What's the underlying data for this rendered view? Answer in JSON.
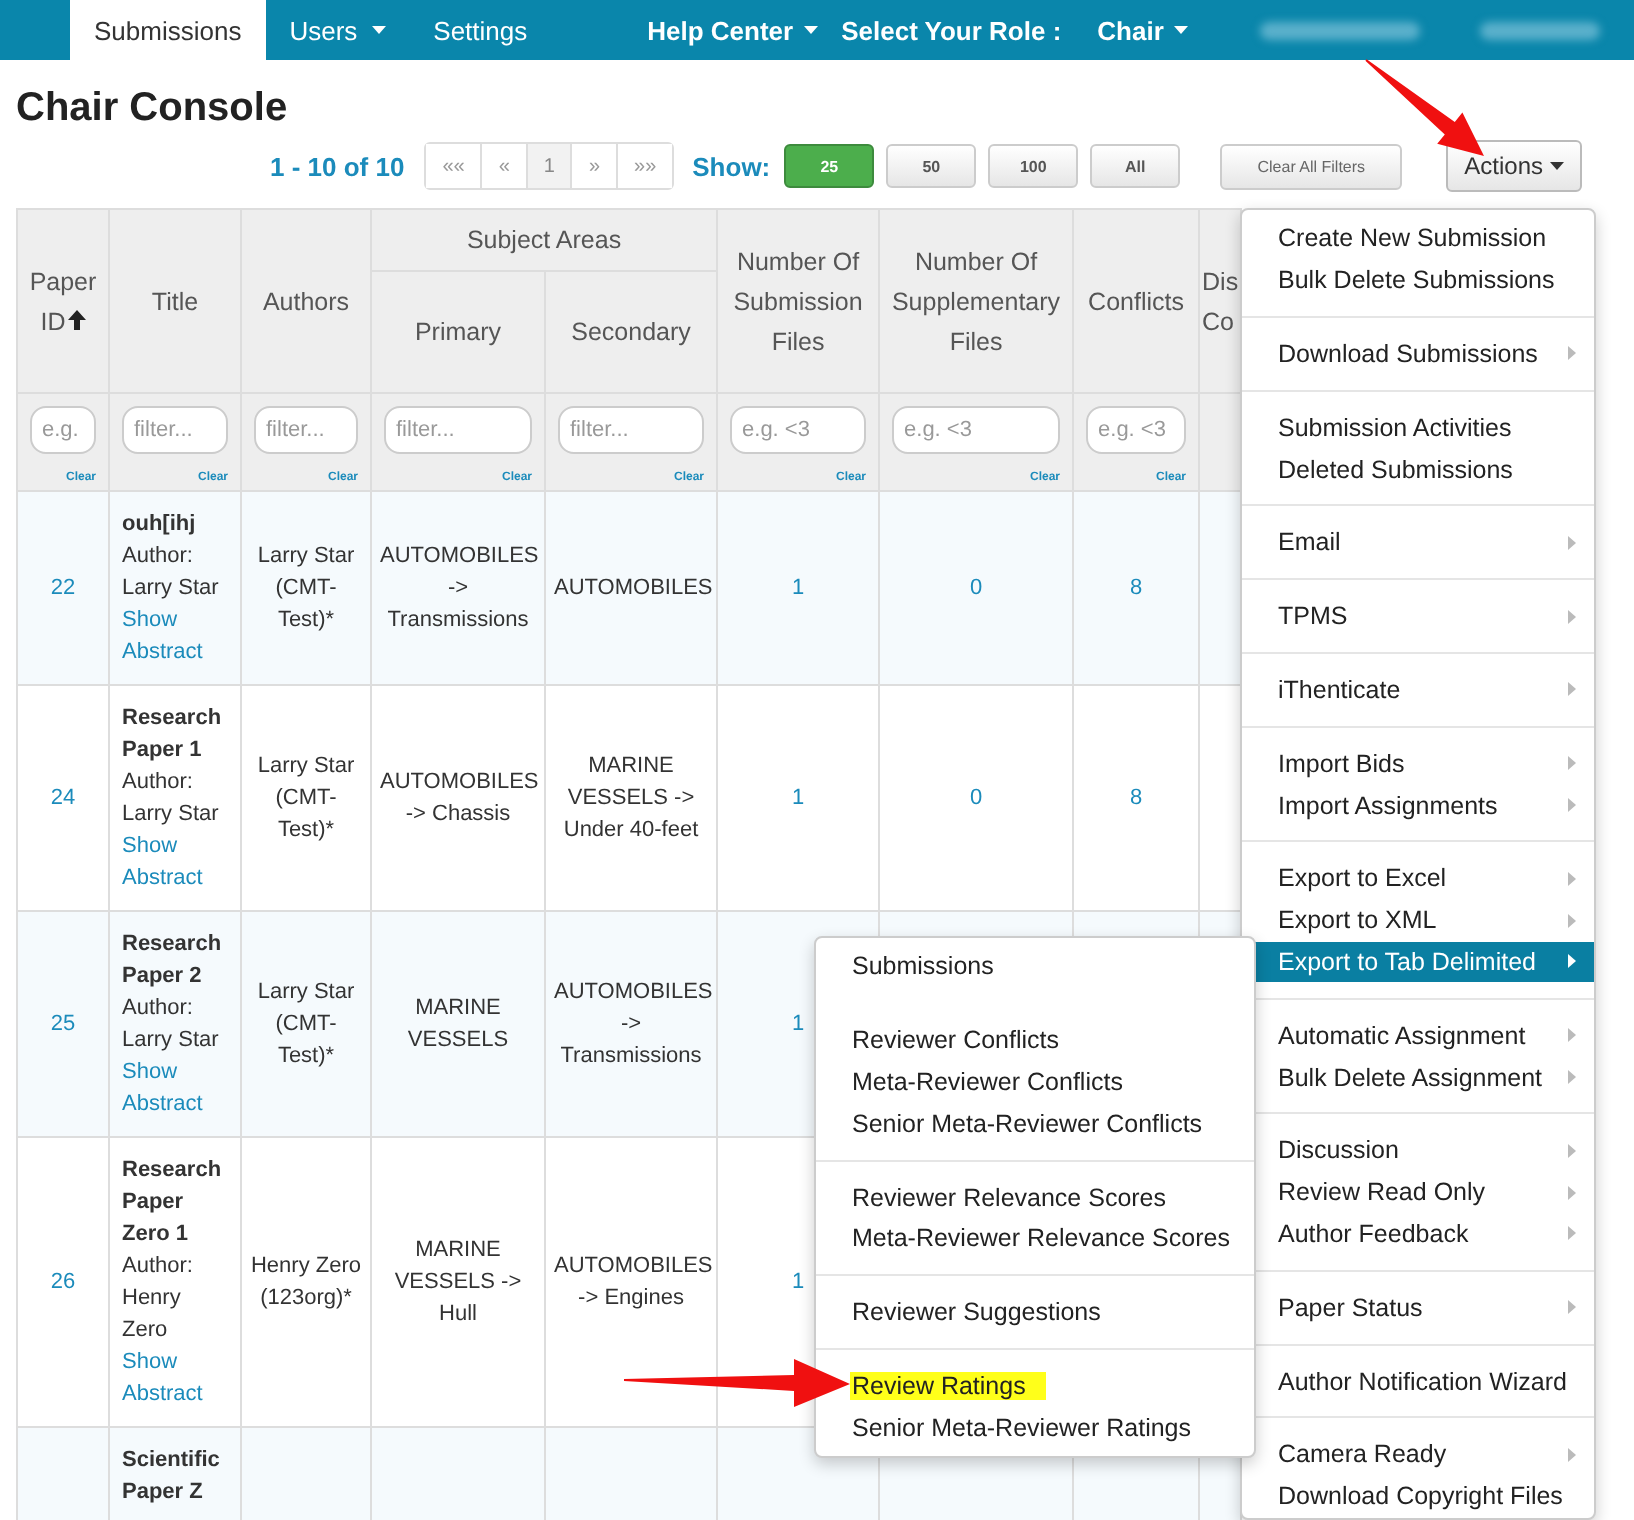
{
  "nav": {
    "tabs": [
      {
        "label": "Submissions",
        "selected": true,
        "dropdown": false
      },
      {
        "label": "Users",
        "selected": false,
        "dropdown": true
      },
      {
        "label": "Settings",
        "selected": false,
        "dropdown": false
      }
    ],
    "help": {
      "label": "Help Center"
    },
    "role_label": "Select Your Role :",
    "role": {
      "label": "Chair"
    }
  },
  "page_title": "Chair Console",
  "pagination": {
    "summary": "1 - 10 of 10",
    "pages": [
      {
        "label": "««",
        "selected": false
      },
      {
        "label": "«",
        "selected": false
      },
      {
        "label": "1",
        "selected": true
      },
      {
        "label": "»",
        "selected": false
      },
      {
        "label": "»»",
        "selected": false
      }
    ]
  },
  "page_size": {
    "label": "Show:",
    "options": [
      {
        "label": "25",
        "selected": true
      },
      {
        "label": "50",
        "selected": false
      },
      {
        "label": "100",
        "selected": false
      },
      {
        "label": "All",
        "selected": false
      }
    ]
  },
  "clear_filters": "Clear All Filters",
  "actions_button": "Actions",
  "table": {
    "group_header": "Subject Areas",
    "columns": [
      {
        "kind": "link",
        "header": "Paper ID",
        "sorted": true,
        "grouped": false,
        "placeholder": "e.g.",
        "clear": "Clear"
      },
      {
        "kind": "title",
        "header": "Title",
        "sorted": false,
        "grouped": false,
        "placeholder": "filter...",
        "clear": "Clear"
      },
      {
        "kind": "text",
        "header": "Authors",
        "sorted": false,
        "grouped": false,
        "placeholder": "filter...",
        "clear": "Clear"
      },
      {
        "kind": "text",
        "header": "Primary",
        "sorted": false,
        "grouped": true,
        "placeholder": "filter...",
        "clear": "Clear"
      },
      {
        "kind": "text",
        "header": "Secondary",
        "sorted": false,
        "grouped": true,
        "placeholder": "filter...",
        "clear": "Clear"
      },
      {
        "kind": "link",
        "header": "Number Of Submission Files",
        "sorted": false,
        "grouped": false,
        "placeholder": "e.g. <3",
        "clear": "Clear"
      },
      {
        "kind": "link",
        "header": "Number Of Supplementary Files",
        "sorted": false,
        "grouped": false,
        "placeholder": "e.g. <3",
        "clear": "Clear"
      },
      {
        "kind": "link",
        "header": "Conflicts",
        "sorted": false,
        "grouped": false,
        "placeholder": "e.g. <3",
        "clear": "Clear"
      },
      {
        "kind": "text",
        "header": "Dis Co",
        "sorted": false,
        "grouped": false
      }
    ],
    "rows": [
      {
        "cells": [
          "22",
          {
            "title": "ouh[ihj",
            "author_label": "Author:",
            "author": "Larry Star",
            "abstract_link": "Show Abstract"
          },
          "Larry Star (CMT-Test)*",
          "AUTOMOBILES -> Transmissions",
          "AUTOMOBILES",
          "1",
          "0",
          "8"
        ]
      },
      {
        "cells": [
          "24",
          {
            "title": "Research Paper 1",
            "author_label": "Author:",
            "author": "Larry Star",
            "abstract_link": "Show Abstract"
          },
          "Larry Star (CMT-Test)*",
          "AUTOMOBILES -> Chassis",
          "MARINE VESSELS -> Under 40-feet",
          "1",
          "0",
          "8"
        ]
      },
      {
        "cells": [
          "25",
          {
            "title": "Research Paper 2",
            "author_label": "Author:",
            "author": "Larry Star",
            "abstract_link": "Show Abstract"
          },
          "Larry Star (CMT-Test)*",
          "MARINE VESSELS",
          "AUTOMOBILES -> Transmissions",
          "1"
        ]
      },
      {
        "cells": [
          "26",
          {
            "title": "Research Paper Zero 1",
            "author_label": "Author:",
            "author": "Henry Zero",
            "abstract_link": "Show Abstract"
          },
          "Henry Zero (123org)*",
          "MARINE VESSELS -> Hull",
          "AUTOMOBILES -> Engines",
          "1"
        ]
      },
      {
        "cells": [
          null,
          {
            "title": "Scientific Paper Z"
          }
        ]
      }
    ]
  },
  "actions_menu": {
    "groups": [
      {
        "divider": false,
        "items": [
          {
            "label": "Create New Submission",
            "submenu": false,
            "selected": false
          },
          {
            "label": "Bulk Delete Submissions",
            "submenu": false,
            "selected": false
          }
        ]
      },
      {
        "divider": true,
        "items": [
          {
            "label": "Download Submissions",
            "submenu": true,
            "selected": false
          }
        ]
      },
      {
        "divider": true,
        "items": [
          {
            "label": "Submission Activities",
            "submenu": false,
            "selected": false
          },
          {
            "label": "Deleted Submissions",
            "submenu": false,
            "selected": false
          }
        ]
      },
      {
        "divider": true,
        "items": [
          {
            "label": "Email",
            "submenu": true,
            "selected": false
          }
        ]
      },
      {
        "divider": true,
        "items": [
          {
            "label": "TPMS",
            "submenu": true,
            "selected": false
          }
        ]
      },
      {
        "divider": true,
        "items": [
          {
            "label": "iThenticate",
            "submenu": true,
            "selected": false
          }
        ]
      },
      {
        "divider": true,
        "items": [
          {
            "label": "Import Bids",
            "submenu": true,
            "selected": false
          },
          {
            "label": "Import Assignments",
            "submenu": true,
            "selected": false
          }
        ]
      },
      {
        "divider": true,
        "items": [
          {
            "label": "Export to Excel",
            "submenu": true,
            "selected": false
          },
          {
            "label": "Export to XML",
            "submenu": true,
            "selected": false
          },
          {
            "label": "Export to Tab Delimited",
            "submenu": true,
            "selected": true
          }
        ]
      },
      {
        "divider": true,
        "items": [
          {
            "label": "Automatic Assignment",
            "submenu": true,
            "selected": false
          },
          {
            "label": "Bulk Delete Assignment",
            "submenu": true,
            "selected": false
          }
        ]
      },
      {
        "divider": true,
        "items": [
          {
            "label": "Discussion",
            "submenu": true,
            "selected": false
          },
          {
            "label": "Review Read Only",
            "submenu": true,
            "selected": false
          },
          {
            "label": "Author Feedback",
            "submenu": true,
            "selected": false
          }
        ]
      },
      {
        "divider": true,
        "items": [
          {
            "label": "Paper Status",
            "submenu": true,
            "selected": false
          }
        ]
      },
      {
        "divider": true,
        "items": [
          {
            "label": "Author Notification Wizard",
            "submenu": false,
            "selected": false
          }
        ]
      },
      {
        "divider": true,
        "items": [
          {
            "label": "Camera Ready",
            "submenu": true,
            "selected": false
          },
          {
            "label": "Download Copyright Files",
            "submenu": false,
            "selected": false
          }
        ]
      }
    ]
  },
  "export_submenu": {
    "groups": [
      {
        "divider": false,
        "items": [
          {
            "label": "Submissions",
            "highlighted": false
          }
        ]
      },
      {
        "divider": false,
        "items": [
          {
            "label": "Reviewer Conflicts",
            "highlighted": false
          },
          {
            "label": "Meta-Reviewer Conflicts",
            "highlighted": false
          },
          {
            "label": "Senior Meta-Reviewer Conflicts",
            "highlighted": false
          }
        ]
      },
      {
        "divider": true,
        "items": [
          {
            "label": "Reviewer Relevance Scores",
            "highlighted": false
          },
          {
            "label": "Meta-Reviewer Relevance Scores",
            "highlighted": false
          }
        ]
      },
      {
        "divider": true,
        "items": [
          {
            "label": "Reviewer Suggestions",
            "highlighted": false
          }
        ]
      },
      {
        "divider": true,
        "items": [
          {
            "label": "Review Ratings",
            "highlighted": true
          },
          {
            "label": "Senior Meta-Reviewer Ratings",
            "highlighted": false
          }
        ]
      }
    ]
  }
}
